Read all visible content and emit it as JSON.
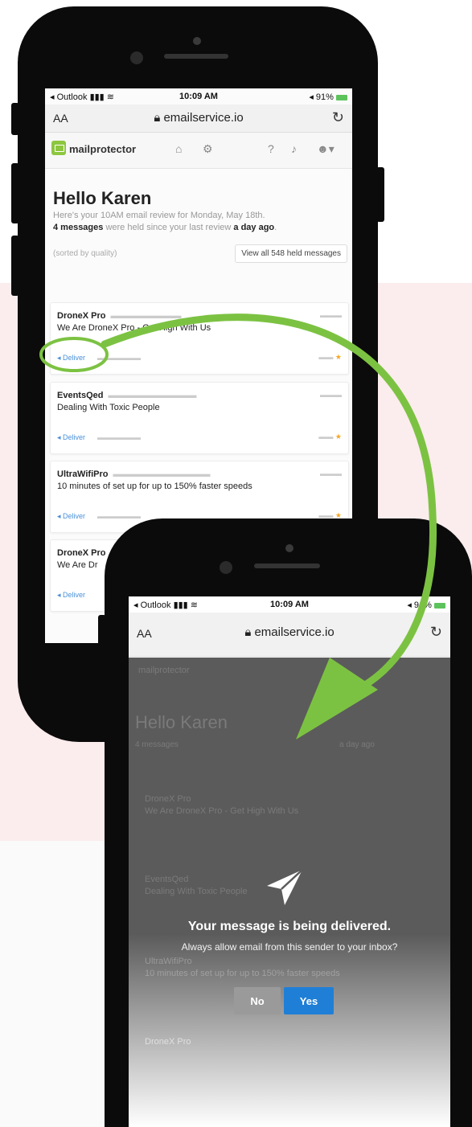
{
  "status": {
    "carrier": "◂ Outlook",
    "time": "10:09 AM",
    "battery": "◂ 91%"
  },
  "browser": {
    "text_size": "AA",
    "url": "emailservice.io"
  },
  "app": {
    "brand": "mailprotector"
  },
  "greeting": {
    "title": "Hello Karen",
    "line1": "Here's your 10AM email review for Monday, May 18th.",
    "count": "4 messages",
    "line2_mid": " were held since your last review ",
    "since": "a day ago",
    "line2_end": "."
  },
  "list": {
    "sorted_label": "(sorted by quality)",
    "view_all_label": "View all 548 held messages"
  },
  "messages": [
    {
      "sender": "DroneX Pro",
      "subject": "We Are DroneX Pro - Get High With Us",
      "deliver": "Deliver"
    },
    {
      "sender": "EventsQed",
      "subject": "Dealing With Toxic People",
      "deliver": "Deliver"
    },
    {
      "sender": "UltraWifiPro",
      "subject": "10 minutes of set up for up to 150% faster speeds",
      "deliver": "Deliver"
    },
    {
      "sender": "DroneX Pro",
      "subject": "We Are Dr",
      "deliver": "Deliver"
    }
  ],
  "ghost": {
    "title": "Hello Karen",
    "count": "4 messages",
    "since": "a day ago"
  },
  "dialog": {
    "title": "Your message is being delivered.",
    "question": "Always allow email from this sender to your inbox?",
    "no_label": "No",
    "yes_label": "Yes"
  },
  "colors": {
    "accent_green": "#8dc63f",
    "arrow_green": "#7cc242",
    "yes_blue": "#1f7fd6",
    "band_pink": "#fbeced"
  }
}
